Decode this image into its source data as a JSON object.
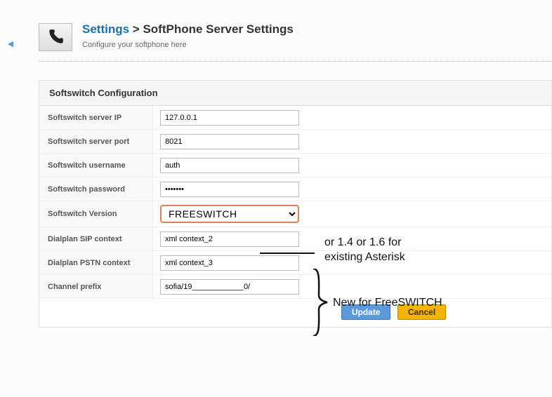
{
  "nav": {
    "back_icon": "◄"
  },
  "header": {
    "breadcrumb_link": "Settings",
    "breadcrumb_sep": " > ",
    "page_title": "SoftPhone Server Settings",
    "subtitle": "Configure your softphone here"
  },
  "panel": {
    "title": "Softswitch Configuration"
  },
  "fields": {
    "server_ip": {
      "label": "Softswitch server IP",
      "value": "127.0.0.1"
    },
    "server_port": {
      "label": "Softswitch server port",
      "value": "8021"
    },
    "username": {
      "label": "Softswitch username",
      "value": "auth"
    },
    "password": {
      "label": "Softswitch password",
      "value": "•••••••"
    },
    "version": {
      "label": "Softswitch Version",
      "value": "FREESWITCH",
      "options": [
        "FREESWITCH"
      ]
    },
    "sip_context": {
      "label": "Dialplan SIP context",
      "value": "xml context_2"
    },
    "pstn_context": {
      "label": "Dialplan PSTN context",
      "value": "xml context_3"
    },
    "channel_prefix": {
      "label": "Channel prefix",
      "value": "sofia/19____________0/"
    }
  },
  "buttons": {
    "update": "Update",
    "cancel": "Cancel"
  },
  "annotations": {
    "version_note_l1": "or 1.4 or 1.6 for",
    "version_note_l2": "existing Asterisk",
    "new_note": "New for FreeSWITCH"
  }
}
